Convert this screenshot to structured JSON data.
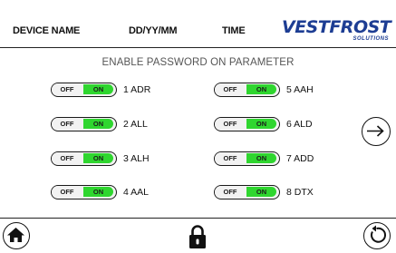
{
  "header": {
    "device_name": "DEVICE NAME",
    "date_format": "DD/YY/MM",
    "time": "TIME",
    "logo_main": "VESTFROST",
    "logo_sub": "SOLUTIONS"
  },
  "main": {
    "title": "ENABLE PASSWORD ON PARAMETER",
    "parameters": [
      {
        "label": "1 ADR",
        "off": "OFF",
        "on": "ON",
        "state": "on"
      },
      {
        "label": "2 ALL",
        "off": "OFF",
        "on": "ON",
        "state": "on"
      },
      {
        "label": "3 ALH",
        "off": "OFF",
        "on": "ON",
        "state": "on"
      },
      {
        "label": "4 AAL",
        "off": "OFF",
        "on": "ON",
        "state": "on"
      },
      {
        "label": "5 AAH",
        "off": "OFF",
        "on": "ON",
        "state": "on"
      },
      {
        "label": "6 ALD",
        "off": "OFF",
        "on": "ON",
        "state": "on"
      },
      {
        "label": "7 ADD",
        "off": "OFF",
        "on": "ON",
        "state": "on"
      },
      {
        "label": "8 DTX",
        "off": "OFF",
        "on": "ON",
        "state": "on"
      }
    ]
  },
  "icons": {
    "next": "arrow-right-icon",
    "home": "home-icon",
    "lock": "lock-icon",
    "back": "back-icon"
  },
  "colors": {
    "toggle_on": "#2fd62f",
    "toggle_off": "#f2f2f2",
    "logo": "#1d3d93"
  }
}
